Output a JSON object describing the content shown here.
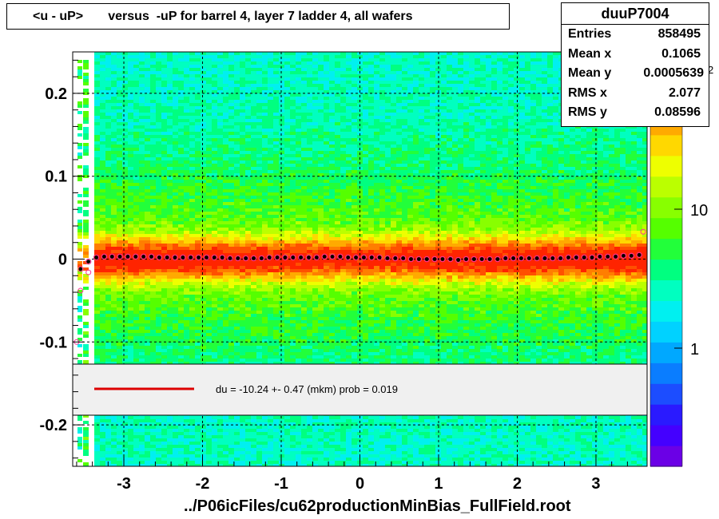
{
  "title": "<u - uP>       versus  -uP for barrel 4, layer 7 ladder 4, all wafers",
  "stats": {
    "name": "duuP7004",
    "rows": [
      {
        "label": "Entries",
        "value": "858495"
      },
      {
        "label": "Mean x",
        "value": "0.1065"
      },
      {
        "label": "Mean y",
        "value": "0.0005639"
      },
      {
        "label": "RMS x",
        "value": "2.077"
      },
      {
        "label": "RMS y",
        "value": "0.08596"
      }
    ]
  },
  "fit_legend": "du =  -10.24 +-  0.47 (mkm) prob = 0.019",
  "footer": "../P06icFiles/cu62productionMinBias_FullField.root",
  "colorbar": {
    "tick_labels": [
      "1",
      "10",
      "10"
    ],
    "exponent": "2"
  },
  "colors": {
    "fit_line": "#dd0000",
    "profile_points": "#000000",
    "profile_open": "#ff3399"
  },
  "chart_data": {
    "type": "heatmap",
    "title": "<u - uP>       versus  -uP for barrel 4, layer 7 ladder 4, all wafers",
    "xlabel": "",
    "ylabel": "",
    "xlim": [
      -3.65,
      3.65
    ],
    "ylim": [
      -0.25,
      0.25
    ],
    "x_ticks": [
      -3,
      -2,
      -1,
      0,
      1,
      2,
      3
    ],
    "x_tick_labels": [
      "-3",
      "-2",
      "-1",
      "0",
      "1",
      "2",
      "3"
    ],
    "y_ticks": [
      0.2,
      0.1,
      0,
      -0.1,
      -0.2
    ],
    "y_tick_labels": [
      "0.2",
      "0.1",
      "0",
      "-0.1",
      "-0.2"
    ],
    "grid": true,
    "z_scale": "log",
    "profile": {
      "x": [
        -3.55,
        -3.45,
        -3.35,
        -3.25,
        -3.15,
        -3.05,
        -2.95,
        -2.85,
        -2.75,
        -2.65,
        -2.55,
        -2.45,
        -2.35,
        -2.25,
        -2.15,
        -2.05,
        -1.95,
        -1.85,
        -1.75,
        -1.65,
        -1.55,
        -1.45,
        -1.35,
        -1.25,
        -1.15,
        -1.05,
        -0.95,
        -0.85,
        -0.75,
        -0.65,
        -0.55,
        -0.45,
        -0.35,
        -0.25,
        -0.15,
        -0.05,
        0.05,
        0.15,
        0.25,
        0.35,
        0.45,
        0.55,
        0.65,
        0.75,
        0.85,
        0.95,
        1.05,
        1.15,
        1.25,
        1.35,
        1.45,
        1.55,
        1.65,
        1.75,
        1.85,
        1.95,
        2.05,
        2.15,
        2.25,
        2.35,
        2.45,
        2.55,
        2.65,
        2.75,
        2.85,
        2.95,
        3.05,
        3.15,
        3.25,
        3.35,
        3.45,
        3.55
      ],
      "y": [
        -0.012,
        -0.003,
        0.002,
        0.003,
        0.003,
        0.003,
        0.003,
        0.003,
        0.003,
        0.003,
        0.002,
        0.002,
        0.002,
        0.002,
        0.002,
        0.002,
        0.002,
        0.002,
        0.002,
        0.001,
        0.001,
        0.001,
        0.001,
        0.001,
        0.002,
        0.002,
        0.002,
        0.002,
        0.002,
        0.002,
        0.002,
        0.003,
        0.003,
        0.003,
        0.002,
        0.002,
        0.002,
        0.002,
        0.002,
        0.001,
        0.001,
        0.001,
        0.0,
        0.0,
        0.0,
        0.0,
        0.0,
        0.0,
        -0.001,
        0.0,
        0.0,
        0.0,
        0.0,
        0.0,
        0.001,
        0.001,
        0.001,
        0.001,
        0.001,
        0.001,
        0.001,
        0.001,
        0.002,
        0.002,
        0.002,
        0.002,
        0.003,
        0.003,
        0.003,
        0.004,
        0.004,
        0.005
      ]
    },
    "outliers_open": {
      "x": [
        -3.6,
        -3.55,
        -3.45,
        3.6
      ],
      "y": [
        -0.1,
        -0.038,
        -0.016,
        0.033
      ]
    },
    "fit": {
      "du": -10.24,
      "error": 0.47,
      "unit": "mkm",
      "prob": 0.019
    }
  }
}
